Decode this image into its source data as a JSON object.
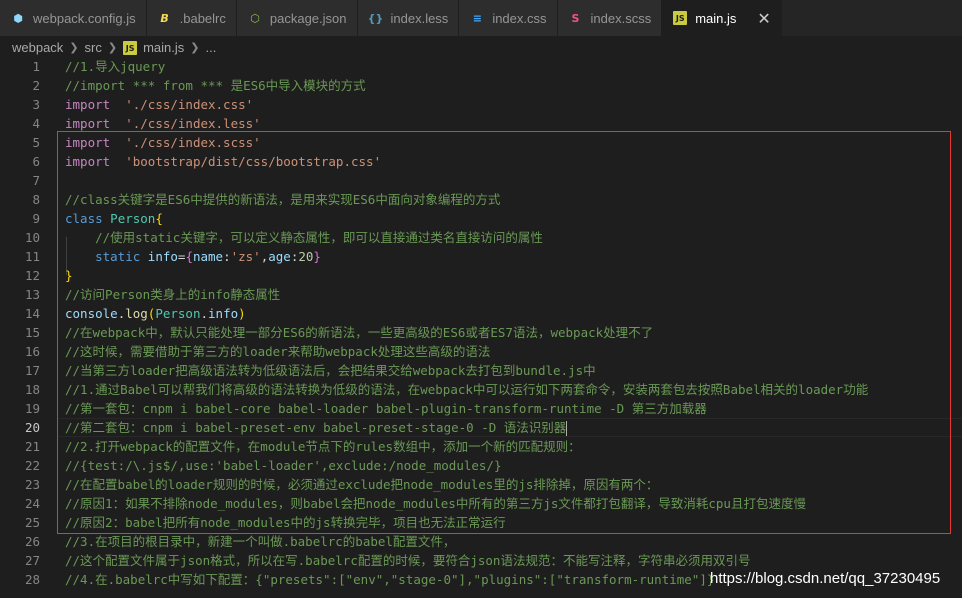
{
  "tabs": [
    {
      "label": "webpack.config.js",
      "icon": "webpack-icon",
      "icon_color": "#8ed6fb"
    },
    {
      "label": ".babelrc",
      "icon": "babel-icon",
      "icon_color": "#f5da55"
    },
    {
      "label": "package.json",
      "icon": "nodejs-icon",
      "icon_color": "#8bc34a"
    },
    {
      "label": "index.less",
      "icon": "braces-icon",
      "icon_color": "#519aba"
    },
    {
      "label": "index.css",
      "icon": "css-icon",
      "icon_color": "#42a5f5"
    },
    {
      "label": "index.scss",
      "icon": "sass-icon",
      "icon_color": "#f55385"
    },
    {
      "label": "main.js",
      "icon": "js-icon",
      "icon_color": "#cbcb41",
      "active": true
    }
  ],
  "breadcrumb": {
    "parts": [
      "webpack",
      "src"
    ],
    "file": "main.js",
    "ellipsis": "..."
  },
  "lines": [
    {
      "n": "1",
      "t": [
        [
          "c",
          "//1.导入jquery"
        ]
      ]
    },
    {
      "n": "2",
      "t": [
        [
          "c",
          "//import *** from *** 是ES6中导入模块的方式"
        ]
      ]
    },
    {
      "n": "3",
      "t": [
        [
          "kw",
          "import"
        ],
        [
          "",
          "  "
        ],
        [
          "s",
          "'./css/index.css'"
        ]
      ]
    },
    {
      "n": "4",
      "t": [
        [
          "kw",
          "import"
        ],
        [
          "",
          "  "
        ],
        [
          "s",
          "'./css/index.less'"
        ]
      ]
    },
    {
      "n": "5",
      "t": [
        [
          "kw",
          "import"
        ],
        [
          "",
          "  "
        ],
        [
          "s",
          "'./css/index.scss'"
        ]
      ]
    },
    {
      "n": "6",
      "t": [
        [
          "kw",
          "import"
        ],
        [
          "",
          "  "
        ],
        [
          "s",
          "'bootstrap/dist/css/bootstrap.css'"
        ]
      ]
    },
    {
      "n": "7",
      "t": []
    },
    {
      "n": "8",
      "t": [
        [
          "c",
          "//class关键字是ES6中提供的新语法，是用来实现ES6中面向对象编程的方式"
        ]
      ]
    },
    {
      "n": "9",
      "t": [
        [
          "k",
          "class"
        ],
        [
          "",
          " "
        ],
        [
          "cl",
          "Person"
        ],
        [
          "br",
          "{"
        ]
      ]
    },
    {
      "n": "10",
      "t": [
        [
          "",
          "    "
        ],
        [
          "c",
          "//使用static关键字，可以定义静态属性，即可以直接通过类名直接访问的属性"
        ]
      ]
    },
    {
      "n": "11",
      "t": [
        [
          "",
          "    "
        ],
        [
          "k",
          "static"
        ],
        [
          "",
          " "
        ],
        [
          "p",
          "info"
        ],
        [
          "",
          "="
        ],
        [
          "br2",
          "{"
        ],
        [
          "p",
          "name"
        ],
        [
          "",
          ":"
        ],
        [
          "s",
          "'zs'"
        ],
        [
          "",
          ","
        ],
        [
          "p",
          "age"
        ],
        [
          "",
          ":"
        ],
        [
          "n",
          "20"
        ],
        [
          "br2",
          "}"
        ]
      ]
    },
    {
      "n": "12",
      "t": [
        [
          "br",
          "}"
        ]
      ]
    },
    {
      "n": "13",
      "t": [
        [
          "c",
          "//访问Person类身上的info静态属性"
        ]
      ]
    },
    {
      "n": "14",
      "t": [
        [
          "p",
          "console"
        ],
        [
          "",
          "."
        ],
        [
          "f",
          "log"
        ],
        [
          "br",
          "("
        ],
        [
          "cl",
          "Person"
        ],
        [
          "",
          "."
        ],
        [
          "p",
          "info"
        ],
        [
          "br",
          ")"
        ]
      ]
    },
    {
      "n": "15",
      "t": [
        [
          "c",
          "//在webpack中，默认只能处理一部分ES6的新语法，一些更高级的ES6或者ES7语法，webpack处理不了"
        ]
      ]
    },
    {
      "n": "16",
      "t": [
        [
          "c",
          "//这时候，需要借助于第三方的loader来帮助webpack处理这些高级的语法"
        ]
      ]
    },
    {
      "n": "17",
      "t": [
        [
          "c",
          "//当第三方loader把高级语法转为低级语法后，会把结果交给webpack去打包到bundle.js中"
        ]
      ]
    },
    {
      "n": "18",
      "t": [
        [
          "c",
          "//1.通过Babel可以帮我们将高级的语法转换为低级的语法，在webpack中可以运行如下两套命令，安装两套包去按照Babel相关的loader功能"
        ]
      ]
    },
    {
      "n": "19",
      "t": [
        [
          "c",
          "//第一套包：cnpm i babel-core babel-loader babel-plugin-transform-runtime -D 第三方加载器"
        ]
      ]
    },
    {
      "n": "20",
      "t": [
        [
          "c",
          "//第二套包：cnpm i babel-preset-env babel-preset-stage-0 -D 语法识别器"
        ]
      ],
      "current": true
    },
    {
      "n": "21",
      "t": [
        [
          "c",
          "//2.打开webpack的配置文件，在module节点下的rules数组中，添加一个新的匹配规则："
        ]
      ]
    },
    {
      "n": "22",
      "t": [
        [
          "c",
          "//{test:/\\.js$/,use:'babel-loader',exclude:/node_modules/}"
        ]
      ]
    },
    {
      "n": "23",
      "t": [
        [
          "c",
          "//在配置babel的loader规则的时候，必须通过exclude把node_modules里的js排除掉，原因有两个："
        ]
      ]
    },
    {
      "n": "24",
      "t": [
        [
          "c",
          "//原因1：如果不排除node_modules，则babel会把node_modules中所有的第三方js文件都打包翻译，导致消耗cpu且打包速度慢"
        ]
      ]
    },
    {
      "n": "25",
      "t": [
        [
          "c",
          "//原因2：babel把所有node_modules中的js转换完毕，项目也无法正常运行"
        ]
      ]
    },
    {
      "n": "26",
      "t": [
        [
          "c",
          "//3.在项目的根目录中，新建一个叫做.babelrc的babel配置文件，"
        ]
      ]
    },
    {
      "n": "27",
      "t": [
        [
          "c",
          "//这个配置文件属于json格式，所以在写.babelrc配置的时候，要符合json语法规范：不能写注释，字符串必须用双引号"
        ]
      ]
    },
    {
      "n": "28",
      "t": [
        [
          "c",
          "//4.在.babelrc中写如下配置：{\"presets\":[\"env\",\"stage-0\"],\"plugins\":[\"transform-runtime\"]}"
        ]
      ]
    }
  ],
  "watermark": "https://blog.csdn.net/qq_37230495",
  "colors": {
    "highlight_border": "#e53935",
    "editor_bg": "#1e1e1e",
    "comment": "#6a9955",
    "string": "#ce9178",
    "keyword": "#569cd6"
  }
}
